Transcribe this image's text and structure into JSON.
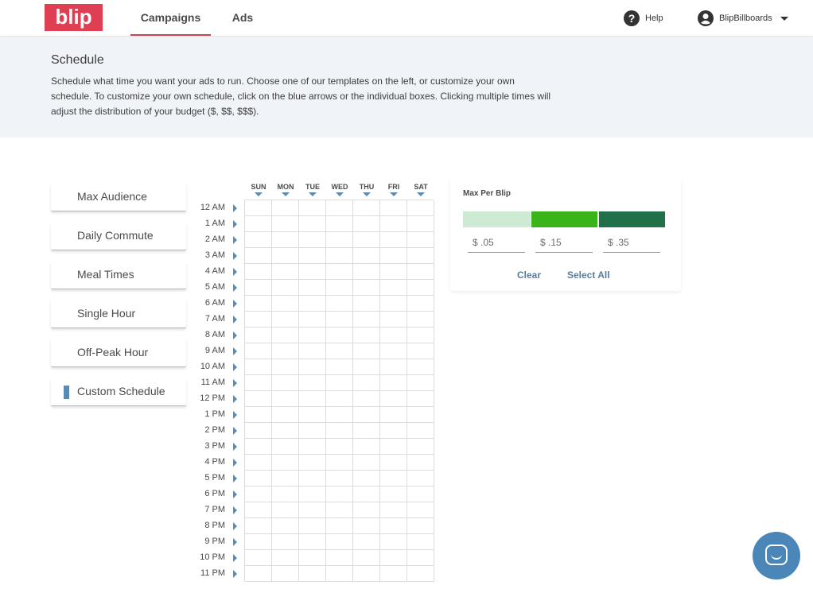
{
  "header": {
    "logo_text": "blip",
    "tabs": [
      {
        "label": "Campaigns",
        "active": true
      },
      {
        "label": "Ads",
        "active": false
      }
    ],
    "help_label": "Help",
    "account_name": "BlipBillboards",
    "accent_color": "#c04a56"
  },
  "intro": {
    "title": "Schedule",
    "text": "Schedule what time you want your ads to run. Choose one of our templates on the left, or customize your own schedule. To customize your own schedule, click on the blue arrows or the individual boxes. Clicking multiple times will adjust the distribution of your budget ($, $$, $$$)."
  },
  "templates": [
    {
      "label": "Max Audience",
      "selected": false
    },
    {
      "label": "Daily Commute",
      "selected": false
    },
    {
      "label": "Meal Times",
      "selected": false
    },
    {
      "label": "Single Hour",
      "selected": false
    },
    {
      "label": "Off-Peak Hour",
      "selected": false
    },
    {
      "label": "Custom Schedule",
      "selected": true
    }
  ],
  "grid": {
    "days": [
      "SUN",
      "MON",
      "TUE",
      "WED",
      "THU",
      "FRI",
      "SAT"
    ],
    "hours": [
      "12 AM",
      "1 AM",
      "2 AM",
      "3 AM",
      "4 AM",
      "5 AM",
      "6 AM",
      "7 AM",
      "8 AM",
      "9 AM",
      "10 AM",
      "11 AM",
      "12 PM",
      "1 PM",
      "2 PM",
      "3 PM",
      "4 PM",
      "5 PM",
      "6 PM",
      "7 PM",
      "8 PM",
      "9 PM",
      "10 PM",
      "11 PM"
    ],
    "arrow_color": "#5b8bb5"
  },
  "budget": {
    "title": "Max Per Blip",
    "levels": [
      {
        "price": "$ .05",
        "color": "#cdebd3"
      },
      {
        "price": "$ .15",
        "color": "#39b51b"
      },
      {
        "price": "$ .35",
        "color": "#22704a"
      }
    ],
    "clear_label": "Clear",
    "select_all_label": "Select All"
  },
  "chat": {
    "icon": "chat-bubble-icon",
    "color": "#4a86b8"
  }
}
